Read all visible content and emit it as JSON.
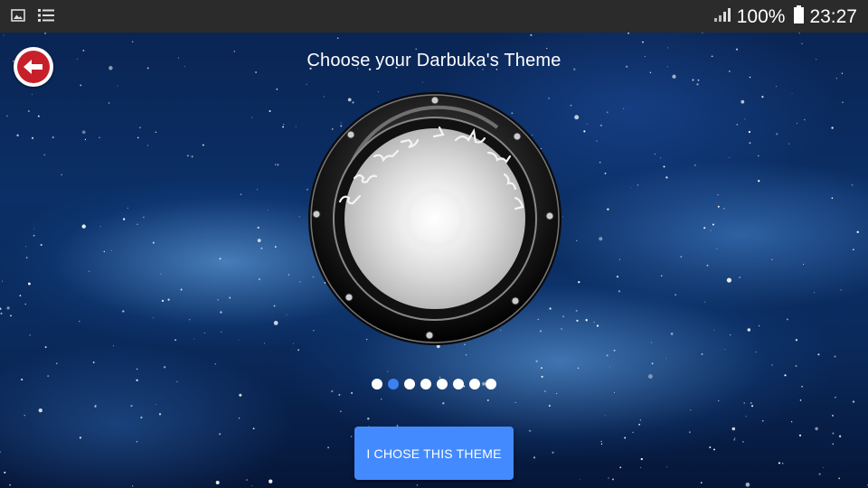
{
  "status_bar": {
    "left_icons": [
      "image-icon",
      "list-icon"
    ],
    "signal_icon": "signal-icon",
    "battery_percent": "100%",
    "battery_icon": "battery-icon",
    "time": "23:27"
  },
  "header": {
    "back_icon": "back-arrow-icon",
    "title": "Choose your Darbuka's Theme"
  },
  "theme_preview": {
    "pager_total": 8,
    "pager_active_index": 1
  },
  "actions": {
    "choose_label": "I CHOSE THIS THEME"
  },
  "colors": {
    "accent": "#448aff",
    "back_button": "#c8202a",
    "dot_active": "#3a82f0",
    "status_bar": "#2b2b2b"
  }
}
